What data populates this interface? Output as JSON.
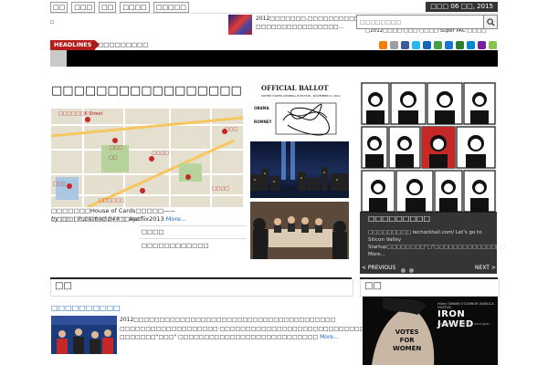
{
  "topnav": [
    "□□",
    "□□□",
    "□□",
    "□□□□",
    "□□□□□"
  ],
  "date": "□□□ 06 □□, 2015",
  "ticker": {
    "line1": "2012□□□□□□□,□□□□□□□□□□□",
    "line2": "□□□□□□□□□□□□□□□□...",
    "sub": "□2012□□□□·□□□·□□□□·Super PAC·□□□□"
  },
  "search": {
    "placeholder": "□□□□□□□□"
  },
  "headlines": {
    "label": "HEADLINES",
    "text": "□□□□□□□□□□"
  },
  "social_colors": [
    "#f57c00",
    "#9e9e9e",
    "#3b5998",
    "#29b6f6",
    "#1565c0",
    "#43a047",
    "#1976d2",
    "#2e7d32",
    "#0288d1",
    "#7b1fa2",
    "#8bc34a"
  ],
  "main": {
    "title": "□□□□□□□□□□□□□□□□□",
    "map_labels": [
      "□□□□□□K Street",
      "□□□",
      "□□",
      "□□□□",
      "□□□",
      "□□□□□□",
      "□□□",
      "□□□□"
    ],
    "caption": "□□□□□□□House of Cards□□□□□——□□□□□□□□□□□□□□Netflix2013",
    "caption_more": "More...",
    "byline": "by □□ | Published 844 □ ago",
    "list": [
      "□□□□",
      "□□□□□□□□□□□□"
    ]
  },
  "ballot": {
    "title": "OFFICIAL BALLOT",
    "sub": "UNITED STATES GENERAL ELECTION · NOVEMBER 6, 2012",
    "opt1": "OBAMA",
    "opt2": "ROMNEY"
  },
  "slider": {
    "title": "□□□□□□□□□",
    "sub1": "□□□□□□□□□ techocktail.com/ Let's go to Silicon Valley",
    "sub2": "Startup□□□□□□□□\"□\"□□□□□□□□□□□□□□□ More...",
    "prev": "< PREVIOUS",
    "next": "NEXT >"
  },
  "bottom": {
    "section_left": "□□",
    "section_right": "□□",
    "article_title": "□□□□□□□□□□",
    "article_text": "2012□□□□□□□□□□□□□□□□□□□□□□□□□□□□□□□□□□□□□□□ □□□□□□□□□□□□□□□□□□□·□□□□□□□□□□□□□□□□□□□□□□□□□□□□□□□□□□□□□□□□□□□□□ □□□□□□□\"□□□\" □□□□□□□□□□□□□□□□□□□□□□□□□□□",
    "article_more": "More...",
    "ad": {
      "line1": "VOTES",
      "line2": "FOR",
      "line3": "WOMEN",
      "brand": "IRON JAWED",
      "names": "Hilary  SWANK  O'CONNOR  ANJELICA HUSTON",
      "tag": "Loud, Hollow and Ah... your god ..."
    }
  }
}
